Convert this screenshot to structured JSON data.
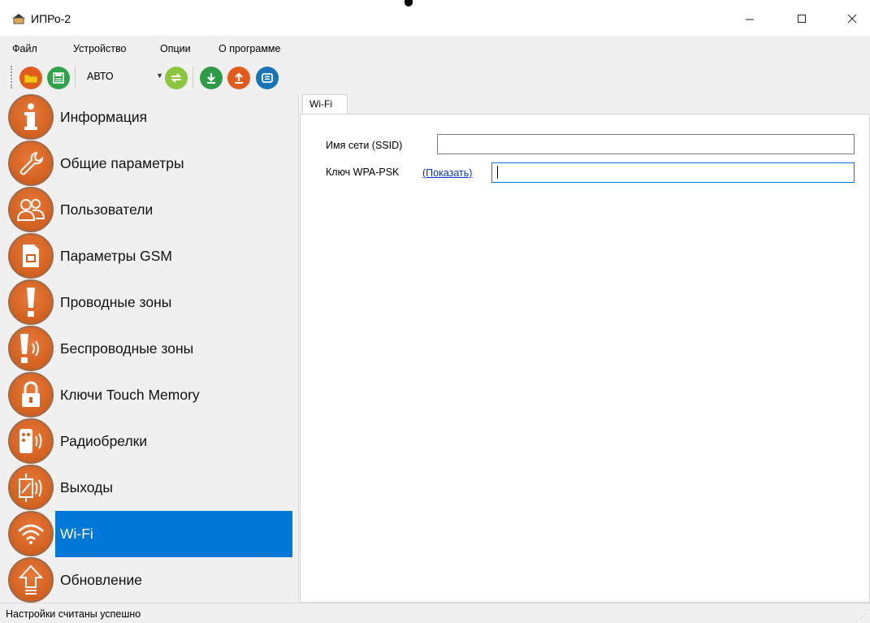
{
  "window": {
    "title": "ИПРо-2"
  },
  "menu": [
    "Файл",
    "Устройство",
    "Опции",
    "О программе"
  ],
  "toolbar": {
    "mode_value": "АВТО",
    "buttons": [
      "open-folder",
      "save",
      "connect",
      "read-from-device",
      "write-to-device",
      "firmware"
    ]
  },
  "sidebar": {
    "items": [
      {
        "label": "Информация",
        "icon": "info-icon"
      },
      {
        "label": "Общие параметры",
        "icon": "wrench-icon"
      },
      {
        "label": "Пользователи",
        "icon": "users-icon"
      },
      {
        "label": "Параметры GSM",
        "icon": "sim-card-icon"
      },
      {
        "label": "Проводные зоны",
        "icon": "exclamation-icon"
      },
      {
        "label": "Беспроводные зоны",
        "icon": "wireless-exclamation-icon"
      },
      {
        "label": "Ключи Touch Memory",
        "icon": "lock-icon"
      },
      {
        "label": "Радиобрелки",
        "icon": "remote-fob-icon"
      },
      {
        "label": "Выходы",
        "icon": "relay-output-icon"
      },
      {
        "label": "Wi-Fi",
        "icon": "wifi-icon",
        "selected": true
      },
      {
        "label": "Обновление",
        "icon": "upload-arrow-icon"
      }
    ]
  },
  "wifi_panel": {
    "tab_label": "Wi-Fi",
    "ssid_label": "Имя сети (SSID)",
    "ssid_value": "",
    "key_label": "Ключ WPA-PSK",
    "show_link": "(Показать)",
    "key_value": ""
  },
  "status": {
    "text": "Настройки считаны успешно"
  },
  "colors": {
    "accent": "#0078d7",
    "icon_orange": "#d2611f",
    "link": "#0033cc"
  }
}
